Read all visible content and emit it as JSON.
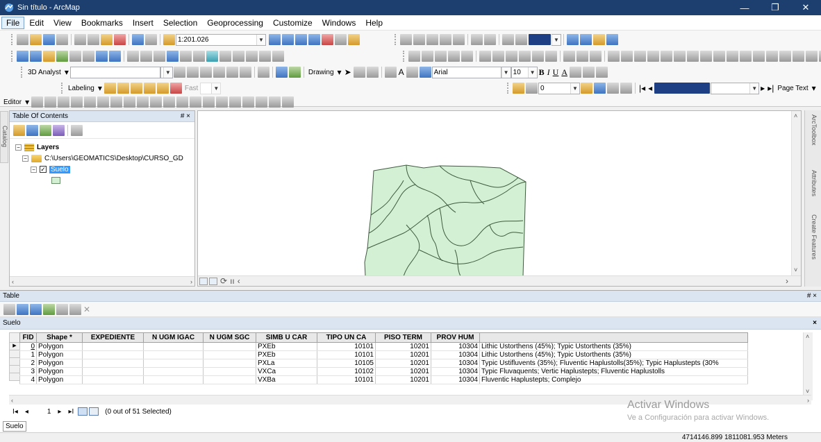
{
  "window": {
    "title": "Sin título - ArcMap",
    "minimize": "—",
    "maximize": "❐",
    "close": "✕"
  },
  "menu": [
    "File",
    "Edit",
    "View",
    "Bookmarks",
    "Insert",
    "Selection",
    "Geoprocessing",
    "Customize",
    "Windows",
    "Help"
  ],
  "toolbar": {
    "scale": "1:201.026",
    "analyst_label": "3D Analyst",
    "drawing_label": "Drawing",
    "font_name": "Arial",
    "font_size": "10",
    "labeling_label": "Labeling",
    "fast_label": "Fast",
    "editor_label": "Editor",
    "page_text_label": "Page Text",
    "bold": "B",
    "italic": "I",
    "underline": "U",
    "text_a": "A",
    "field_value": "0"
  },
  "toc": {
    "title": "Table Of Contents",
    "pin": "# ×",
    "layers_label": "Layers",
    "path": "C:\\Users\\GEOMATICS\\Desktop\\CURSO_GD",
    "layer_name": "Suelo"
  },
  "catalog_tab": "Catalog",
  "right_dock": {
    "toolbox": "ArcToolbox",
    "attributes": "Attributes",
    "create_features": "Create Features"
  },
  "table": {
    "window_title": "Table",
    "pin": "# ×",
    "tab_title": "Suelo",
    "close": "×",
    "columns": [
      "FID",
      "Shape *",
      "EXPEDIENTE",
      "N UGM IGAC",
      "N UGM SGC",
      "SIMB U CAR",
      "TIPO UN CA",
      "PISO TERM",
      "PROV HUM",
      ""
    ],
    "rows": [
      [
        "0",
        "Polygon",
        "",
        "",
        "",
        "PXEb",
        "10101",
        "10201",
        "10304",
        "Lithic Ustorthens (45%); Typic Ustorthents (35%)"
      ],
      [
        "1",
        "Polygon",
        "",
        "",
        "",
        "PXEb",
        "10101",
        "10201",
        "10304",
        "Lithic Ustorthens (45%); Typic Ustorthents (35%)"
      ],
      [
        "2",
        "Polygon",
        "",
        "",
        "",
        "PXLa",
        "10105",
        "10201",
        "10304",
        "Typic Ustifluvents (35%); Fluventic Haplustolls(35%); Typic Haplustepts (30%"
      ],
      [
        "3",
        "Polygon",
        "",
        "",
        "",
        "VXCa",
        "10102",
        "10201",
        "10304",
        "Typic Fluvaquents; Vertic Haplustepts; Fluventic Haplustolls"
      ],
      [
        "4",
        "Polygon",
        "",
        "",
        "",
        "VXBa",
        "10101",
        "10201",
        "10304",
        "Fluventic Haplustepts; Complejo"
      ]
    ],
    "nav_current": "1",
    "selection_status": "(0 out of 51 Selected)",
    "sheet_tab": "Suelo"
  },
  "watermark": {
    "line1": "Activar Windows",
    "line2": "Ve a Configuración para activar Windows."
  },
  "status": {
    "coords": "4714146.899  1811081.953 Meters"
  },
  "colors": {
    "title_bar": "#1c3f70",
    "polygon_fill": "#d4f0d4",
    "polygon_stroke": "#3d5a3d",
    "selection": "#3399ff",
    "panel_header": "#dbe5f1"
  }
}
